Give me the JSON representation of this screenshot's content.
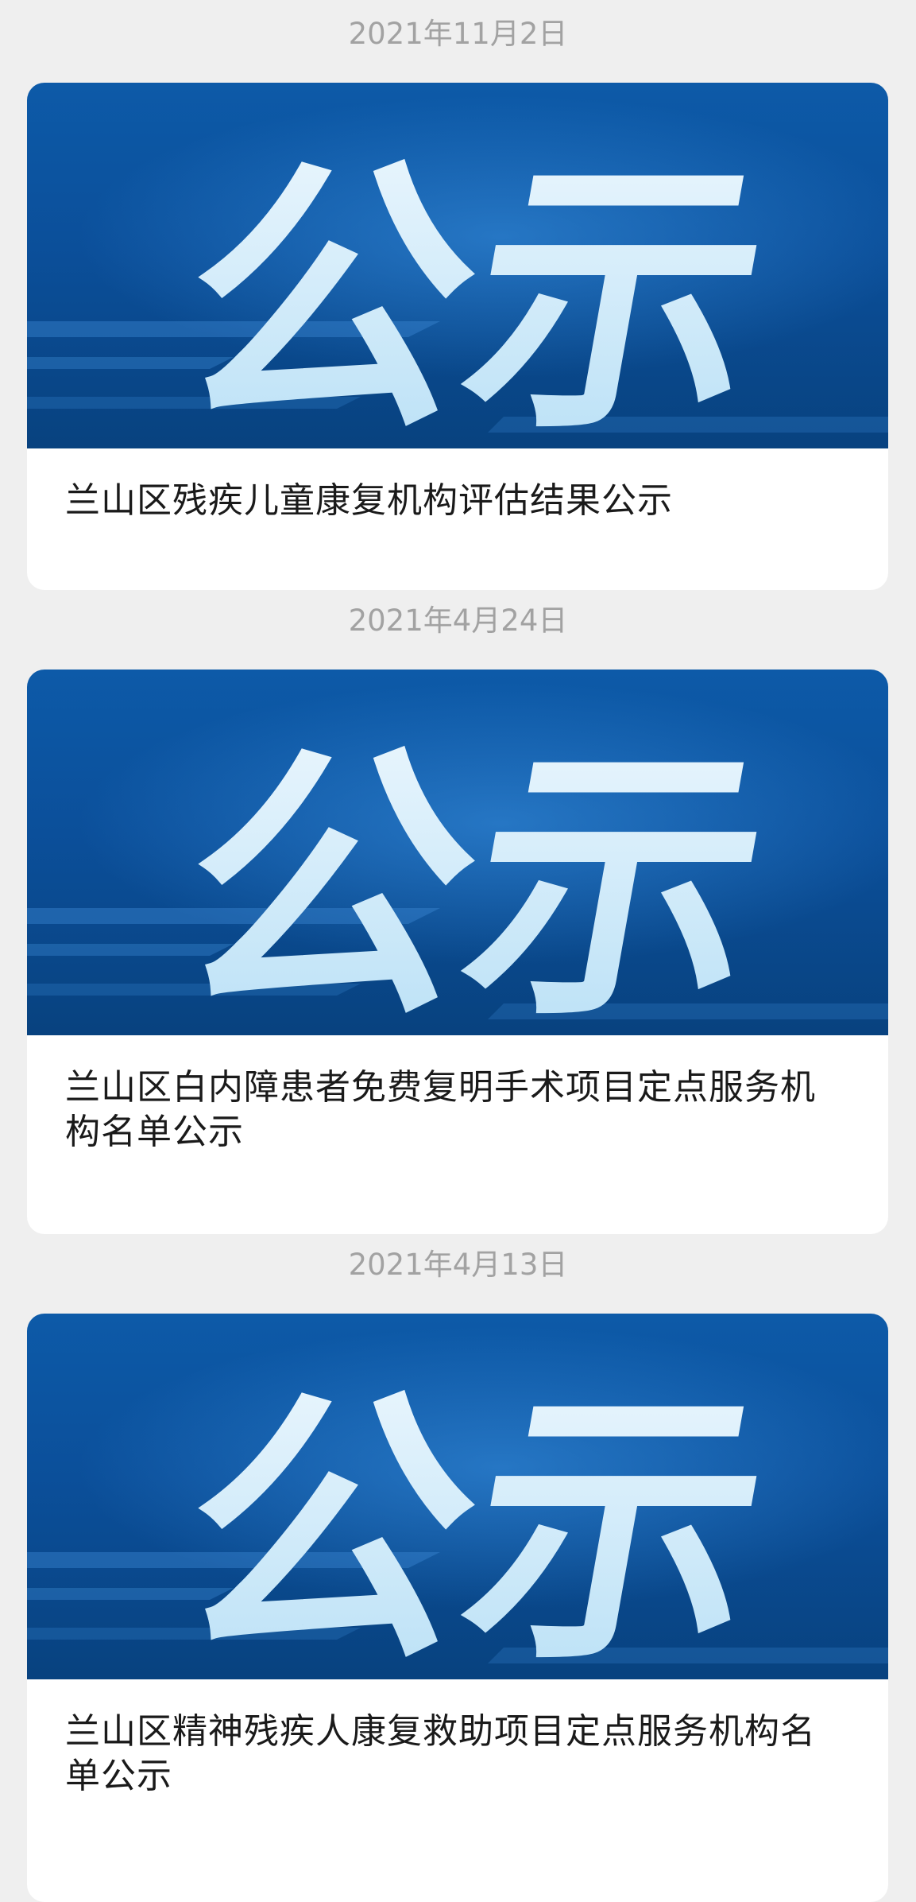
{
  "colors": {
    "page_bg": "#efefef",
    "banner_blue": "#0b4f9a",
    "date_gray": "#a2a2a2",
    "title_text": "#1a1a1a"
  },
  "articles": [
    {
      "date": "2021年11月2日",
      "banner_text": "公示",
      "title": "兰山区残疾儿童康复机构评估结果公示"
    },
    {
      "date": "2021年4月24日",
      "banner_text": "公示",
      "title": "兰山区白内障患者免费复明手术项目定点服务机构名单公示"
    },
    {
      "date": "2021年4月13日",
      "banner_text": "公示",
      "title": "兰山区精神残疾人康复救助项目定点服务机构名单公示"
    }
  ]
}
